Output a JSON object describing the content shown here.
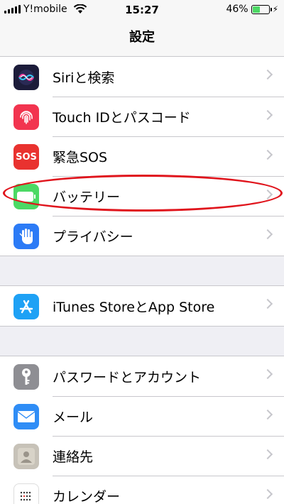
{
  "status_bar": {
    "carrier": "Y!mobile",
    "time": "15:27",
    "battery_percent": "46%",
    "battery_level": 0.46,
    "battery_color": "#4cd964"
  },
  "nav": {
    "title": "設定"
  },
  "groups": [
    {
      "items": [
        {
          "label": "Siriと検索",
          "icon": "siri-icon",
          "color": "#1c1c3a"
        },
        {
          "label": "Touch IDとパスコード",
          "icon": "fingerprint-icon",
          "color": "#f2344f"
        },
        {
          "label": "緊急SOS",
          "icon": "sos-icon",
          "color": "#e9322f",
          "icon_text": "SOS"
        },
        {
          "label": "バッテリー",
          "icon": "battery-icon",
          "color": "#4cd964",
          "highlighted": true
        },
        {
          "label": "プライバシー",
          "icon": "hand-icon",
          "color": "#2c7bf6"
        }
      ]
    },
    {
      "items": [
        {
          "label": "iTunes StoreとApp Store",
          "icon": "app-store-icon",
          "color": "#1ea1f5"
        }
      ]
    },
    {
      "items": [
        {
          "label": "パスワードとアカウント",
          "icon": "key-icon",
          "color": "#8e8e93"
        },
        {
          "label": "メール",
          "icon": "mail-icon",
          "color": "#2f8df6"
        },
        {
          "label": "連絡先",
          "icon": "contacts-icon",
          "color": "#c7c2b8"
        },
        {
          "label": "カレンダー",
          "icon": "calendar-icon",
          "color": "#ffffff"
        }
      ]
    }
  ]
}
